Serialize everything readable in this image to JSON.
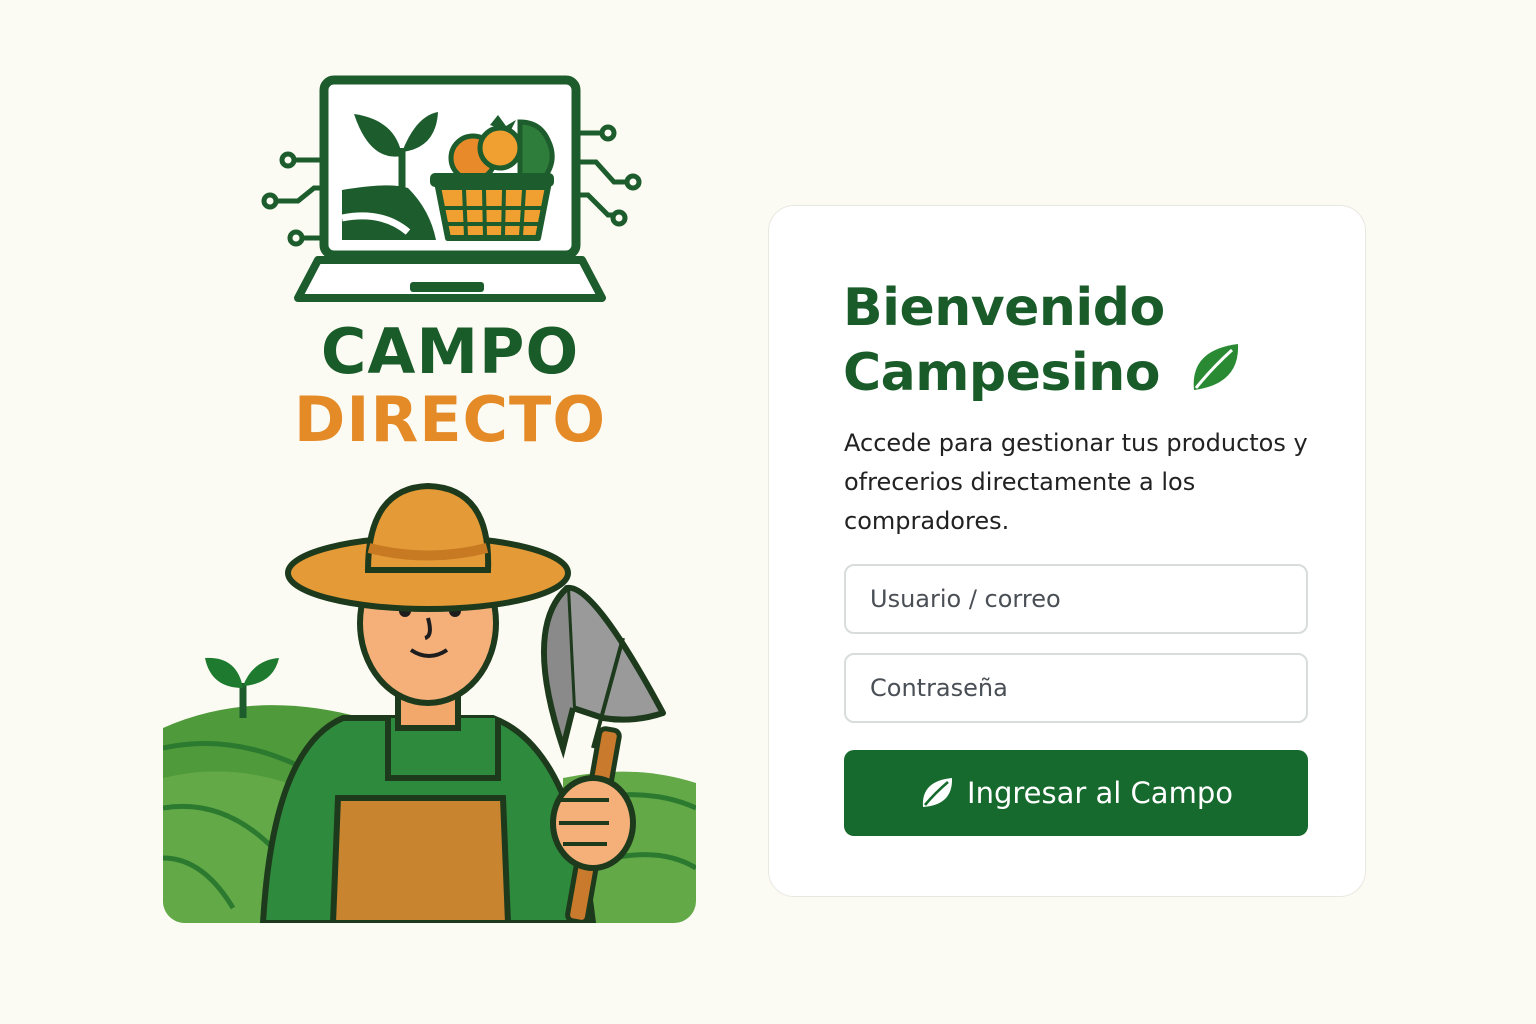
{
  "brand": {
    "line1": "CAMPO",
    "line2": "DIRECTO",
    "icon": "laptop-farm-logo"
  },
  "illustration": {
    "icon": "farmer-with-shovel"
  },
  "login": {
    "title_line1": "Bienvenido",
    "title_line2": "Campesino",
    "title_icon": "leaf-icon",
    "subtitle": "Accede para gestionar tus productos y ofrecerios directamente a los compradores.",
    "username_placeholder": "Usuario / correo",
    "password_placeholder": "Contraseña",
    "submit_label": "Ingresar al Campo",
    "submit_icon": "leaf-icon"
  },
  "colors": {
    "background": "#fcfbf3",
    "primary_green": "#176a2e",
    "dark_green": "#1a5b2a",
    "accent_orange": "#e48a26"
  }
}
